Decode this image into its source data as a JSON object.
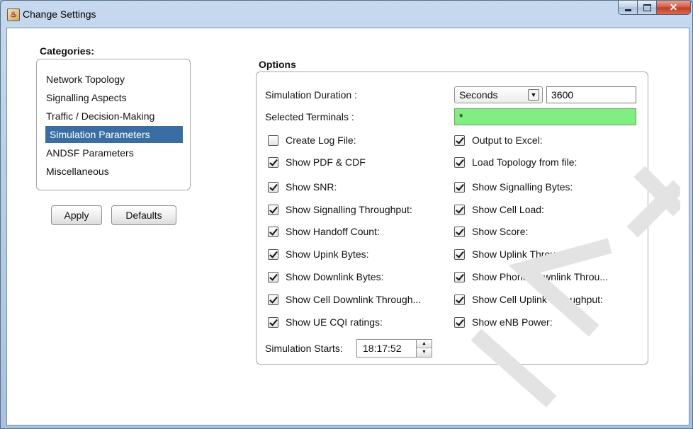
{
  "window": {
    "title": "Change Settings",
    "close_glyph": "✕"
  },
  "categories": {
    "label": "Categories:",
    "items": [
      {
        "label": "Network Topology",
        "selected": false
      },
      {
        "label": "Signalling Aspects",
        "selected": false
      },
      {
        "label": "Traffic / Decision-Making",
        "selected": false
      },
      {
        "label": "Simulation Parameters",
        "selected": true
      },
      {
        "label": "ANDSF Parameters",
        "selected": false
      },
      {
        "label": "Miscellaneous",
        "selected": false
      }
    ]
  },
  "buttons": {
    "apply": "Apply",
    "defaults": "Defaults"
  },
  "options": {
    "label": "Options",
    "duration_label": "Simulation Duration :",
    "duration_unit": "Seconds",
    "duration_value": "3600",
    "terminals_label": "Selected Terminals :",
    "terminals_value": "*",
    "left_checks": [
      {
        "label": "Create Log File:",
        "checked": false
      },
      {
        "label": "Show PDF & CDF",
        "checked": true
      },
      {
        "label": "Show SNR:",
        "checked": true
      },
      {
        "label": "Show Signalling Throughput:",
        "checked": true
      },
      {
        "label": "Show Handoff Count:",
        "checked": true
      },
      {
        "label": "Show Upink Bytes:",
        "checked": true
      },
      {
        "label": "Show Downlink Bytes:",
        "checked": true
      },
      {
        "label": "Show Cell Downlink Through...",
        "checked": true
      },
      {
        "label": "Show UE CQI ratings:",
        "checked": true
      }
    ],
    "right_checks": [
      {
        "label": "Output to Excel:",
        "checked": true
      },
      {
        "label": "Load Topology from file:",
        "checked": true
      },
      {
        "label": "Show Signalling Bytes:",
        "checked": true
      },
      {
        "label": "Show Cell Load:",
        "checked": true
      },
      {
        "label": "Show Score:",
        "checked": true
      },
      {
        "label": "Show Uplink Throughput:",
        "checked": true
      },
      {
        "label": "Show Phone Downlink Throu...",
        "checked": true
      },
      {
        "label": "Show Cell Uplink Throughput:",
        "checked": true
      },
      {
        "label": "Show eNB Power:",
        "checked": true
      }
    ],
    "starts_label": "Simulation Starts:",
    "starts_value": "18:17:52"
  },
  "colors": {
    "selection": "#3a6ea2",
    "terminals_field": "#80ee80",
    "close_button": "#c23a22"
  },
  "icons": [
    "java-app-icon",
    "minimize-icon",
    "maximize-icon",
    "close-icon",
    "dropdown-arrow-icon",
    "spinner-up-icon",
    "spinner-down-icon",
    "checkbox-icon"
  ]
}
